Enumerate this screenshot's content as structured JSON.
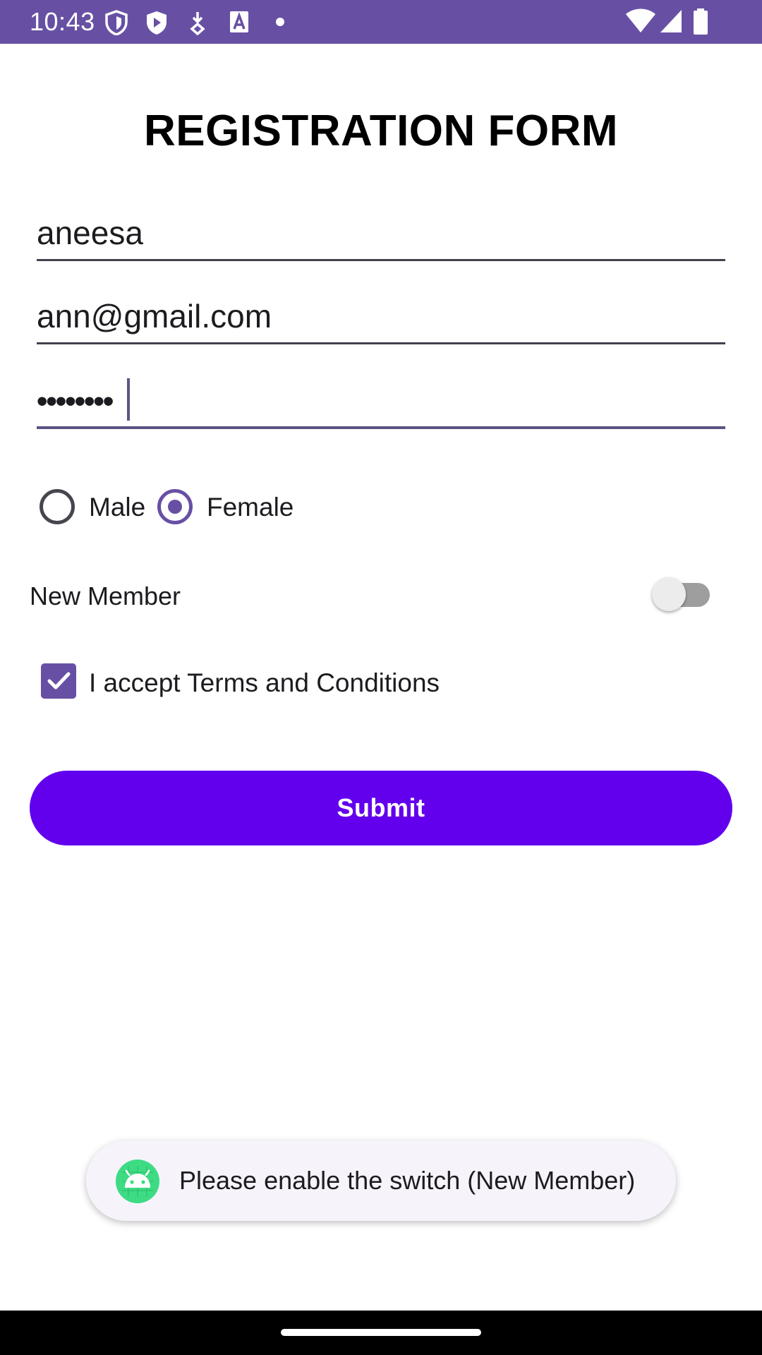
{
  "status_bar": {
    "time": "10:43",
    "icons_left": [
      "shield-icon",
      "play-protect-icon",
      "download-icon",
      "font-a-icon",
      "dot-icon"
    ],
    "icons_right": [
      "wifi-icon",
      "signal-icon",
      "battery-icon"
    ],
    "background_color": "#6750A4"
  },
  "form": {
    "title": "REGISTRATION FORM",
    "name_value": "aneesa",
    "email_value": "ann@gmail.com",
    "password_value": "••••••••",
    "gender": {
      "options": [
        {
          "label": "Male",
          "checked": false
        },
        {
          "label": "Female",
          "checked": true
        }
      ]
    },
    "new_member": {
      "label": "New Member",
      "enabled": false
    },
    "terms": {
      "label": "I accept Terms and Conditions",
      "checked": true
    },
    "submit_label": "Submit",
    "accent_color": "#6750A4",
    "button_color": "#6200EE"
  },
  "toast": {
    "message": "Please enable the switch (New Member)",
    "icon": "android-icon"
  }
}
